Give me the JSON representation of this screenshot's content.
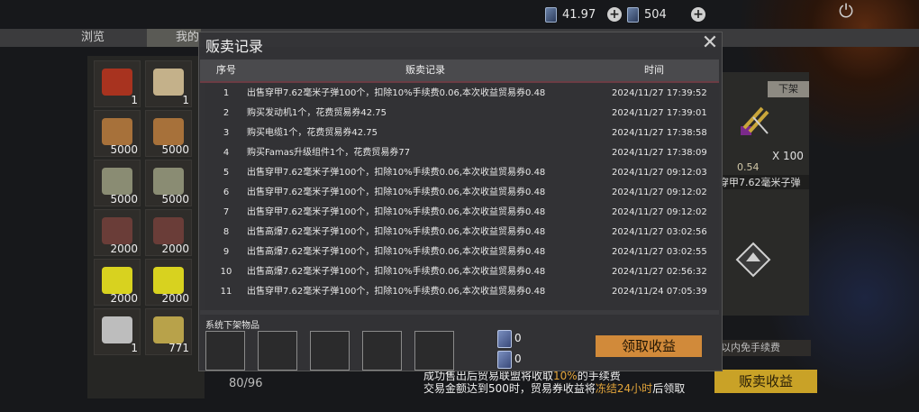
{
  "topbar": {
    "currency_a": "41.97",
    "currency_b": "504",
    "plus_symbol": "+",
    "power_icon": "power-icon"
  },
  "tabs": [
    {
      "label": "浏览"
    },
    {
      "label": "我的"
    }
  ],
  "inventory": {
    "items": [
      {
        "qty": "1",
        "icon": "backpack-icon",
        "color": "#a8331f"
      },
      {
        "qty": "1",
        "icon": "map-icon",
        "color": "#c4b18a"
      },
      {
        "qty": "5000",
        "icon": "logs-icon",
        "color": "#a7713a"
      },
      {
        "qty": "5000",
        "icon": "logs-icon",
        "color": "#a7713a"
      },
      {
        "qty": "5000",
        "icon": "stone-icon",
        "color": "#8a8c73"
      },
      {
        "qty": "5000",
        "icon": "stone-icon",
        "color": "#8a8c73"
      },
      {
        "qty": "2000",
        "icon": "ingot-icon",
        "color": "#6a3d38"
      },
      {
        "qty": "2000",
        "icon": "ingot-icon",
        "color": "#6a3d38"
      },
      {
        "qty": "2000",
        "icon": "sulfur-icon",
        "color": "#d8d21f"
      },
      {
        "qty": "2000",
        "icon": "sulfur-icon",
        "color": "#d8d21f"
      },
      {
        "qty": "1",
        "icon": "bucket-icon",
        "color": "#bdbdbd"
      },
      {
        "qty": "771",
        "icon": "powder-icon",
        "color": "#b8a24a"
      }
    ],
    "capacity": "80/96"
  },
  "detail_panel": {
    "unlist_label": "下架",
    "quantity": "X 100",
    "price": "0.54",
    "item_name": "穿甲7.62毫米子弹"
  },
  "fee_note": "以内免手续费",
  "bottom_info": {
    "line1_prefix": "成功售出后贸易联盟将收取",
    "line1_highlight": "10%",
    "line1_suffix": "的手续费",
    "line2_prefix": "交易金额达到500时，贸易券收益将",
    "line2_highlight": "冻结24小时",
    "line2_suffix": "后领取"
  },
  "sell_income_button": "贩卖收益",
  "modal": {
    "title": "贩卖记录",
    "columns": {
      "index": "序号",
      "record": "贩卖记录",
      "time": "时间"
    },
    "rows": [
      {
        "idx": "1",
        "record": "出售穿甲7.62毫米子弹100个，扣除10%手续费0.06,本次收益贸易券0.48",
        "time": "2024/11/27 17:39:52"
      },
      {
        "idx": "2",
        "record": "购买发动机1个，花费贸易券42.75",
        "time": "2024/11/27 17:39:01"
      },
      {
        "idx": "3",
        "record": "购买电缆1个，花费贸易券42.75",
        "time": "2024/11/27 17:38:58"
      },
      {
        "idx": "4",
        "record": "购买Famas升级组件1个，花费贸易券77",
        "time": "2024/11/27 17:38:09"
      },
      {
        "idx": "5",
        "record": "出售穿甲7.62毫米子弹100个，扣除10%手续费0.06,本次收益贸易券0.48",
        "time": "2024/11/27 09:12:03"
      },
      {
        "idx": "6",
        "record": "出售穿甲7.62毫米子弹100个，扣除10%手续费0.06,本次收益贸易券0.48",
        "time": "2024/11/27 09:12:02"
      },
      {
        "idx": "7",
        "record": "出售穿甲7.62毫米子弹100个，扣除10%手续费0.06,本次收益贸易券0.48",
        "time": "2024/11/27 09:12:02"
      },
      {
        "idx": "8",
        "record": "出售高爆7.62毫米子弹100个，扣除10%手续费0.06,本次收益贸易券0.48",
        "time": "2024/11/27 03:02:56"
      },
      {
        "idx": "9",
        "record": "出售高爆7.62毫米子弹100个，扣除10%手续费0.06,本次收益贸易券0.48",
        "time": "2024/11/27 03:02:55"
      },
      {
        "idx": "10",
        "record": "出售高爆7.62毫米子弹100个，扣除10%手续费0.06,本次收益贸易券0.48",
        "time": "2024/11/27 02:56:32"
      },
      {
        "idx": "11",
        "record": "出售穿甲7.62毫米子弹100个，扣除10%手续费0.06,本次收益贸易券0.48",
        "time": "2024/11/24 07:05:39"
      }
    ],
    "system_unlisted_label": "系统下架物品",
    "ticket_count_a": "0",
    "ticket_count_b": "0",
    "claim_button": "领取收益",
    "close_icon": "close-icon"
  }
}
